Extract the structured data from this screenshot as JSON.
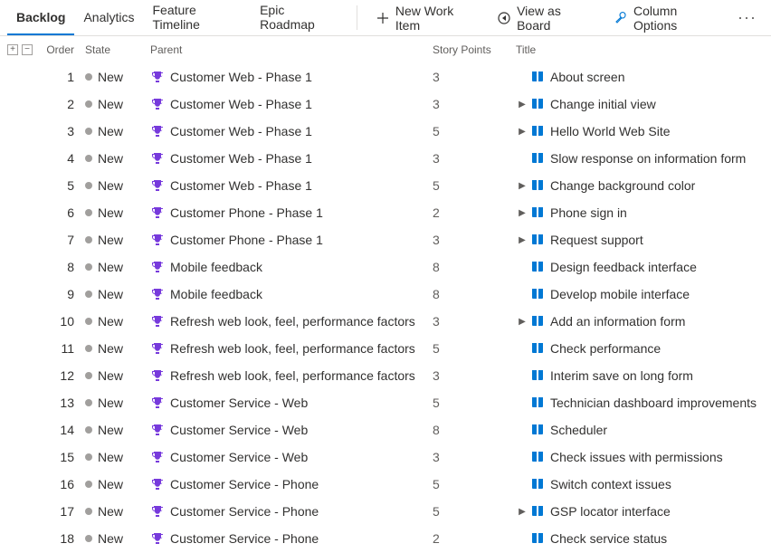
{
  "tabs": [
    {
      "label": "Backlog",
      "active": true
    },
    {
      "label": "Analytics",
      "active": false
    },
    {
      "label": "Feature Timeline",
      "active": false
    },
    {
      "label": "Epic Roadmap",
      "active": false
    }
  ],
  "actions": {
    "new_item": "New Work Item",
    "view_board": "View as Board",
    "column_options": "Column Options"
  },
  "columns": {
    "order": "Order",
    "state": "State",
    "parent": "Parent",
    "points": "Story Points",
    "title": "Title"
  },
  "rows": [
    {
      "order": "1",
      "state": "New",
      "parent": "Customer Web - Phase 1",
      "points": "3",
      "title": "About screen",
      "hasChildren": false
    },
    {
      "order": "2",
      "state": "New",
      "parent": "Customer Web - Phase 1",
      "points": "3",
      "title": "Change initial view",
      "hasChildren": true
    },
    {
      "order": "3",
      "state": "New",
      "parent": "Customer Web - Phase 1",
      "points": "5",
      "title": "Hello World Web Site",
      "hasChildren": true
    },
    {
      "order": "4",
      "state": "New",
      "parent": "Customer Web - Phase 1",
      "points": "3",
      "title": "Slow response on information form",
      "hasChildren": false
    },
    {
      "order": "5",
      "state": "New",
      "parent": "Customer Web - Phase 1",
      "points": "5",
      "title": "Change background color",
      "hasChildren": true
    },
    {
      "order": "6",
      "state": "New",
      "parent": "Customer Phone - Phase 1",
      "points": "2",
      "title": "Phone sign in",
      "hasChildren": true
    },
    {
      "order": "7",
      "state": "New",
      "parent": "Customer Phone - Phase 1",
      "points": "3",
      "title": "Request support",
      "hasChildren": true
    },
    {
      "order": "8",
      "state": "New",
      "parent": "Mobile feedback",
      "points": "8",
      "title": "Design feedback interface",
      "hasChildren": false
    },
    {
      "order": "9",
      "state": "New",
      "parent": "Mobile feedback",
      "points": "8",
      "title": "Develop mobile interface",
      "hasChildren": false
    },
    {
      "order": "10",
      "state": "New",
      "parent": "Refresh web look, feel, performance factors",
      "points": "3",
      "title": "Add an information form",
      "hasChildren": true
    },
    {
      "order": "11",
      "state": "New",
      "parent": "Refresh web look, feel, performance factors",
      "points": "5",
      "title": "Check performance",
      "hasChildren": false
    },
    {
      "order": "12",
      "state": "New",
      "parent": "Refresh web look, feel, performance factors",
      "points": "3",
      "title": "Interim save on long form",
      "hasChildren": false
    },
    {
      "order": "13",
      "state": "New",
      "parent": "Customer Service - Web",
      "points": "5",
      "title": "Technician dashboard improvements",
      "hasChildren": false
    },
    {
      "order": "14",
      "state": "New",
      "parent": "Customer Service - Web",
      "points": "8",
      "title": "Scheduler",
      "hasChildren": false
    },
    {
      "order": "15",
      "state": "New",
      "parent": "Customer Service - Web",
      "points": "3",
      "title": "Check issues with permissions",
      "hasChildren": false
    },
    {
      "order": "16",
      "state": "New",
      "parent": "Customer Service - Phone",
      "points": "5",
      "title": "Switch context issues",
      "hasChildren": false
    },
    {
      "order": "17",
      "state": "New",
      "parent": "Customer Service - Phone",
      "points": "5",
      "title": "GSP locator interface",
      "hasChildren": true
    },
    {
      "order": "18",
      "state": "New",
      "parent": "Customer Service - Phone",
      "points": "2",
      "title": "Check service status",
      "hasChildren": false
    }
  ]
}
